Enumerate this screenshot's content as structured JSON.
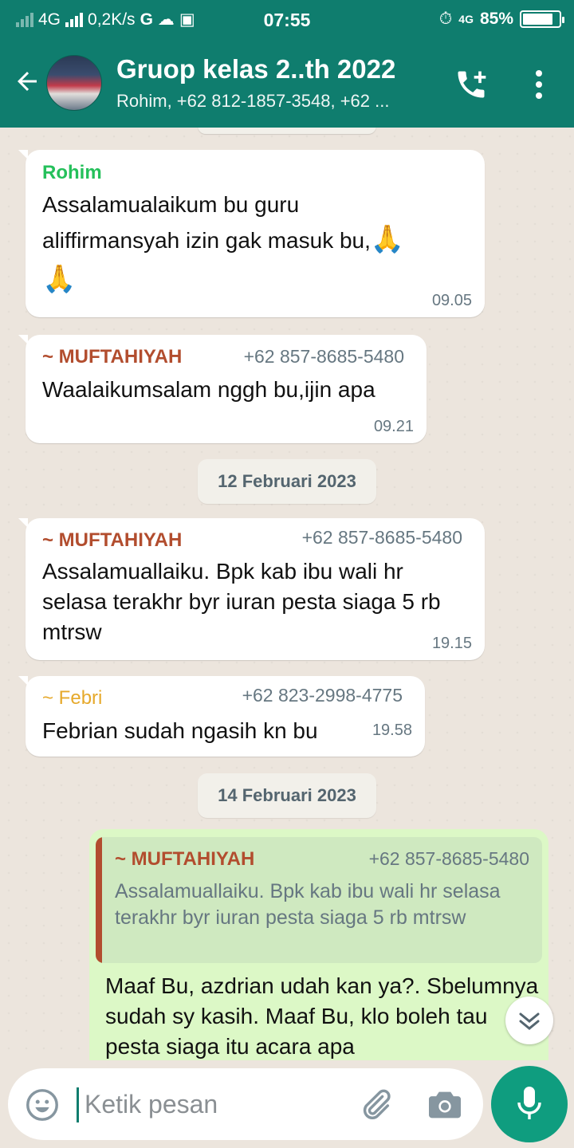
{
  "status_bar": {
    "network": "4G",
    "speed": "0,2K/s",
    "time": "07:55",
    "network_right": "4G",
    "battery_percent_text": "85%",
    "battery_level": 0.85
  },
  "header": {
    "title": "Gruop kelas  2..th  2022",
    "subtitle": "Rohim, +62 812-1857-3548, +62 ..."
  },
  "colors": {
    "header": "#0f7d6e",
    "rohim": "#25c05b",
    "muftahiyah": "#b24d2e",
    "febri": "#e6a92b",
    "outgoing_bubble": "#dcf8c6"
  },
  "messages": [
    {
      "sender": "Rohim",
      "text_line1": "Assalamualaikum bu guru",
      "text_line2": "aliffirmansyah izin gak masuk bu,",
      "emoji": "🙏",
      "time": "09.05"
    },
    {
      "sender": "~ MUFTAHIYAH",
      "phone": "+62 857-8685-5480",
      "text": "Waalaikumsalam nggh bu,ijin apa",
      "time": "09.21"
    },
    {
      "sender": "~ MUFTAHIYAH",
      "phone": "+62 857-8685-5480",
      "text": "Assalamuallaiku. Bpk kab ibu wali hr selasa terakhr byr iuran pesta siaga 5 rb mtrsw",
      "time": "19.15"
    },
    {
      "sender": "~ Febri",
      "phone": "+62 823-2998-4775",
      "text": "Febrian sudah ngasih kn bu",
      "time": "19.58"
    }
  ],
  "dates": [
    "12 Februari 2023",
    "14 Februari 2023"
  ],
  "outgoing": {
    "quote_sender": "~ MUFTAHIYAH",
    "quote_phone": "+62 857-8685-5480",
    "quote_text": "Assalamuallaiku. Bpk kab ibu wali hr selasa terakhr byr iuran pesta siaga 5 rb mtrsw",
    "text": "Maaf Bu, azdrian udah kan ya?. Sbelumnya sudah sy kasih. Maaf Bu, klo boleh tau pesta siaga itu acara apa"
  },
  "input": {
    "placeholder": "Ketik pesan"
  },
  "icons": [
    "back-arrow-icon",
    "add-call-icon",
    "more-vertical-icon",
    "emoji-icon",
    "attach-icon",
    "camera-icon",
    "mic-icon",
    "chevron-down-icon"
  ]
}
